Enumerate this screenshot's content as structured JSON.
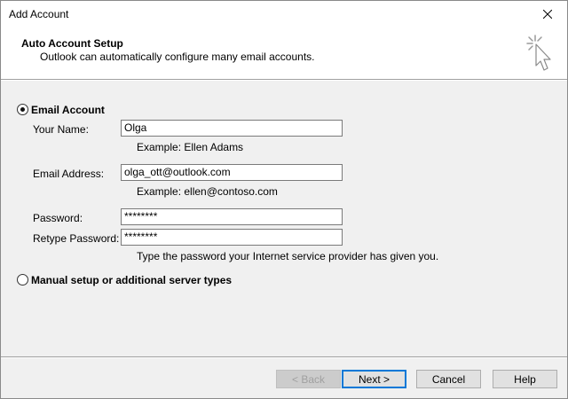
{
  "window": {
    "title": "Add Account",
    "close_glyph": "✕"
  },
  "header": {
    "title": "Auto Account Setup",
    "subtitle": "Outlook can automatically configure many email accounts.",
    "graphic_icon": "cursor-sparkle-icon"
  },
  "email_account": {
    "option_label": "Email Account",
    "selected": true,
    "your_name": {
      "label": "Your Name:",
      "value": "Olga",
      "hint": "Example: Ellen Adams"
    },
    "email_address": {
      "label": "Email Address:",
      "value": "olga_ott@outlook.com",
      "hint": "Example: ellen@contoso.com"
    },
    "password": {
      "label": "Password:",
      "value": "********"
    },
    "retype_password": {
      "label": "Retype Password:",
      "value": "********",
      "hint": "Type the password your Internet service provider has given you."
    }
  },
  "manual_setup": {
    "option_label": "Manual setup or additional server types",
    "selected": false
  },
  "buttons": {
    "back": "< Back",
    "next": "Next >",
    "cancel": "Cancel",
    "help": "Help"
  },
  "colors": {
    "dialog_bg": "#f0f0f0",
    "header_bg": "#ffffff",
    "default_button_border": "#0078d7"
  }
}
